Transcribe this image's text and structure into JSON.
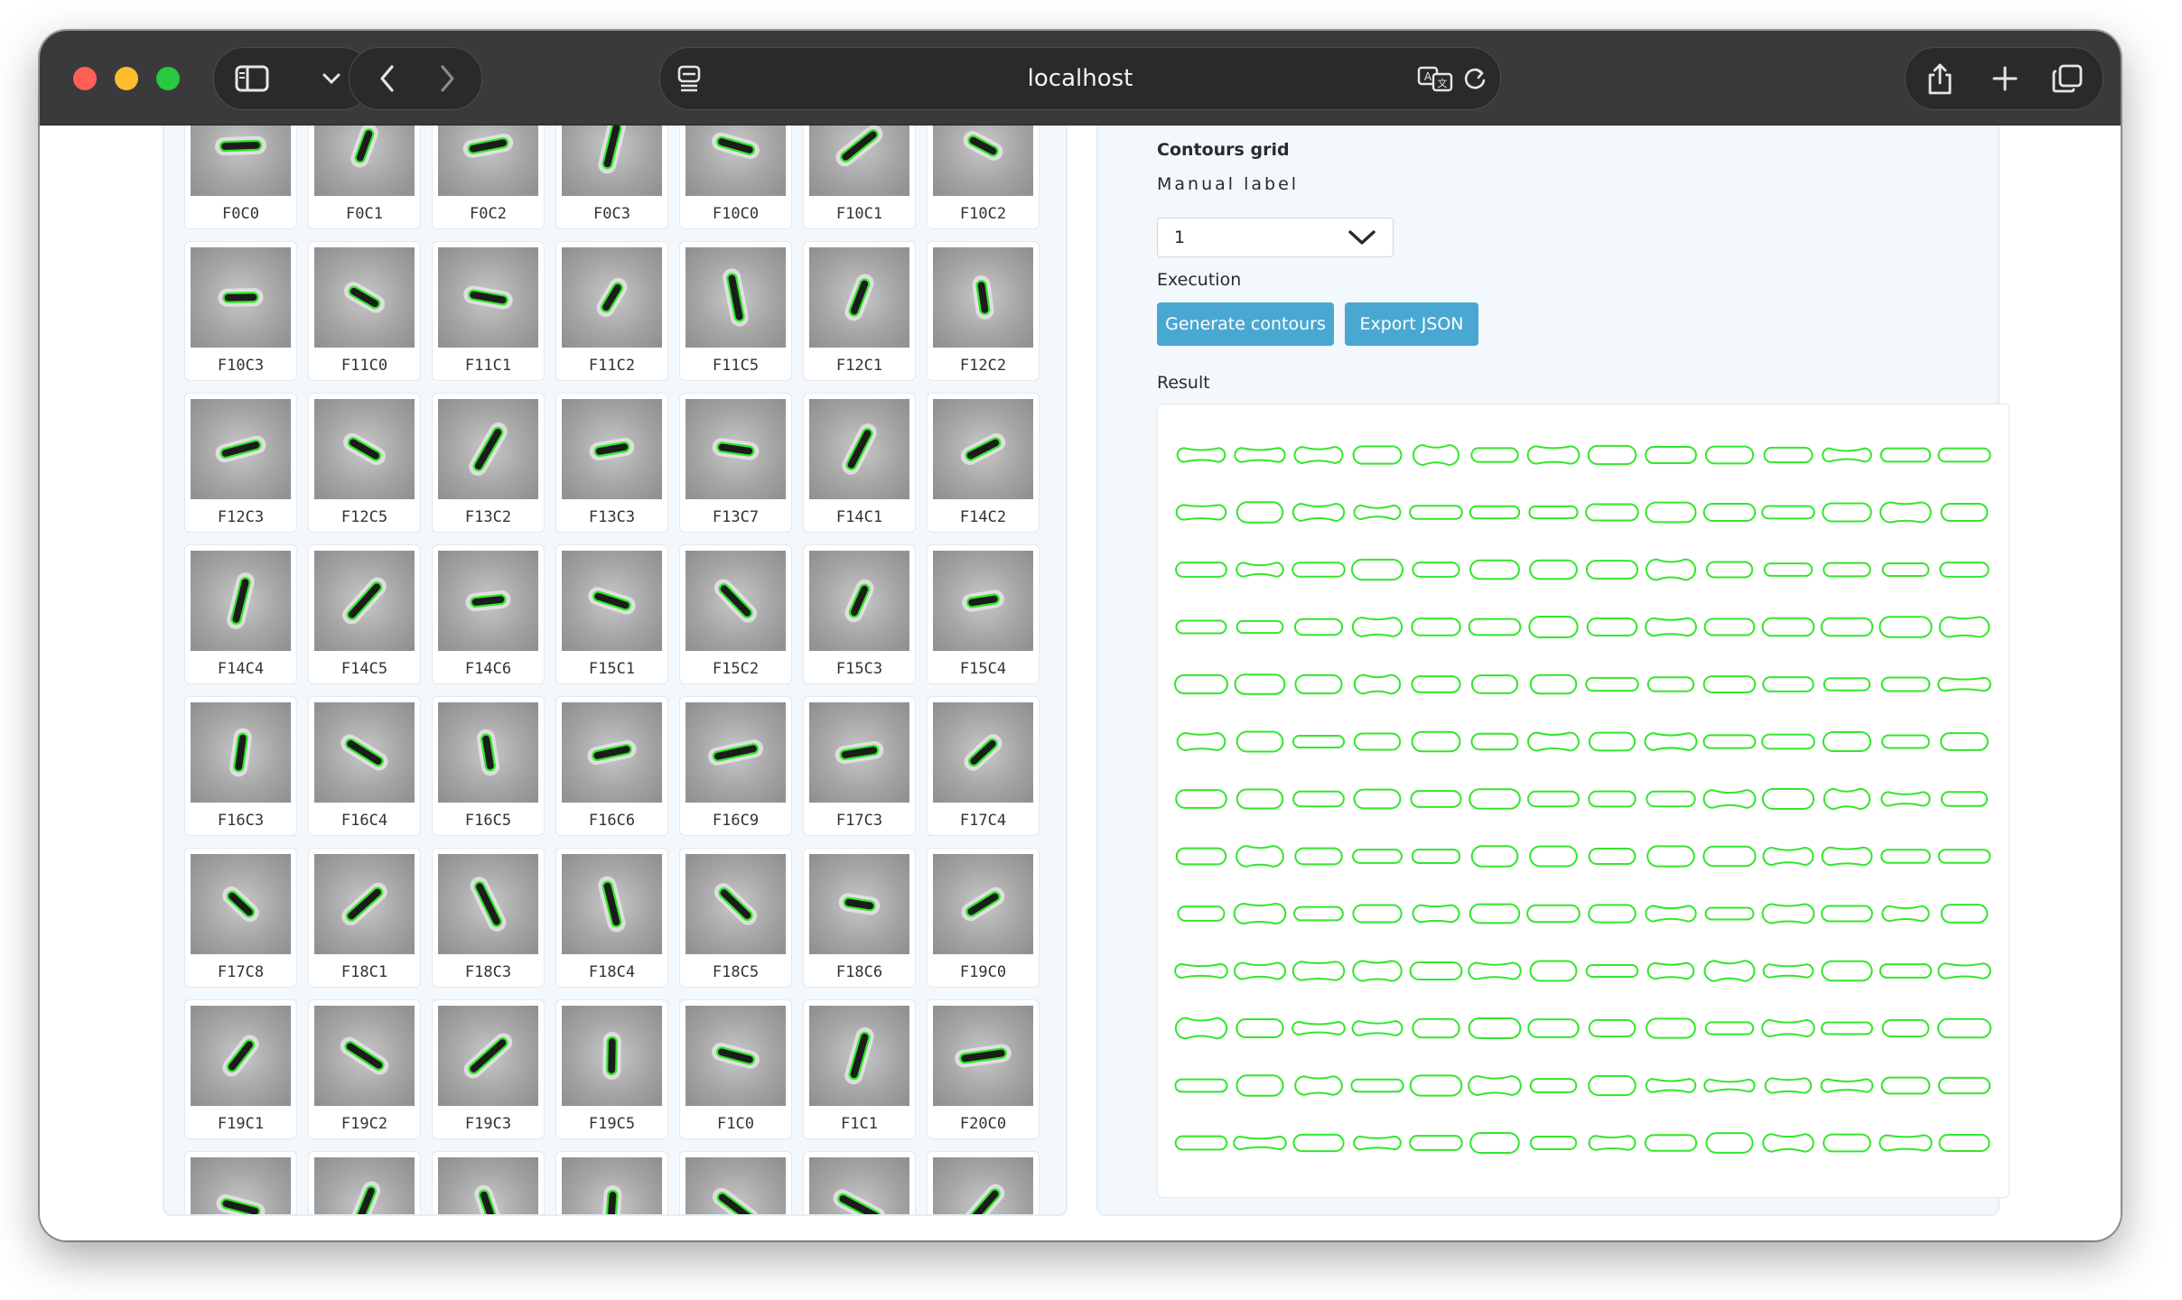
{
  "browser": {
    "url": "localhost",
    "icons": [
      "sidebar-icon",
      "chevron-down-icon",
      "back-icon",
      "forward-icon",
      "page-icon",
      "translate-icon",
      "reload-icon",
      "share-icon",
      "new-tab-icon",
      "tabs-icon"
    ]
  },
  "thumbnails": [
    [
      "F0C0",
      "F0C1",
      "F0C2",
      "F0C3",
      "F10C0",
      "F10C1",
      "F10C2"
    ],
    [
      "F10C3",
      "F11C0",
      "F11C1",
      "F11C2",
      "F11C5",
      "F12C1",
      "F12C2"
    ],
    [
      "F12C3",
      "F12C5",
      "F13C2",
      "F13C3",
      "F13C7",
      "F14C1",
      "F14C2"
    ],
    [
      "F14C4",
      "F14C5",
      "F14C6",
      "F15C1",
      "F15C2",
      "F15C3",
      "F15C4"
    ],
    [
      "F16C3",
      "F16C4",
      "F16C5",
      "F16C6",
      "F16C9",
      "F17C3",
      "F17C4"
    ],
    [
      "F17C8",
      "F18C1",
      "F18C3",
      "F18C4",
      "F18C5",
      "F18C6",
      "F19C0"
    ],
    [
      "F19C1",
      "F19C2",
      "F19C3",
      "F19C5",
      "F1C0",
      "F1C1",
      "F20C0"
    ],
    [
      "",
      "",
      "",
      "",
      "",
      "",
      ""
    ]
  ],
  "right": {
    "section_title": "Contours grid",
    "manual_label": "Manual label",
    "select_value": "1",
    "execution_label": "Execution",
    "generate_button": "Generate contours",
    "export_button": "Export JSON",
    "result_label": "Result"
  },
  "colors": {
    "accent_button": "#48a8d1",
    "contour": "#33e62a",
    "cell_dark": "#1c1c1c"
  }
}
